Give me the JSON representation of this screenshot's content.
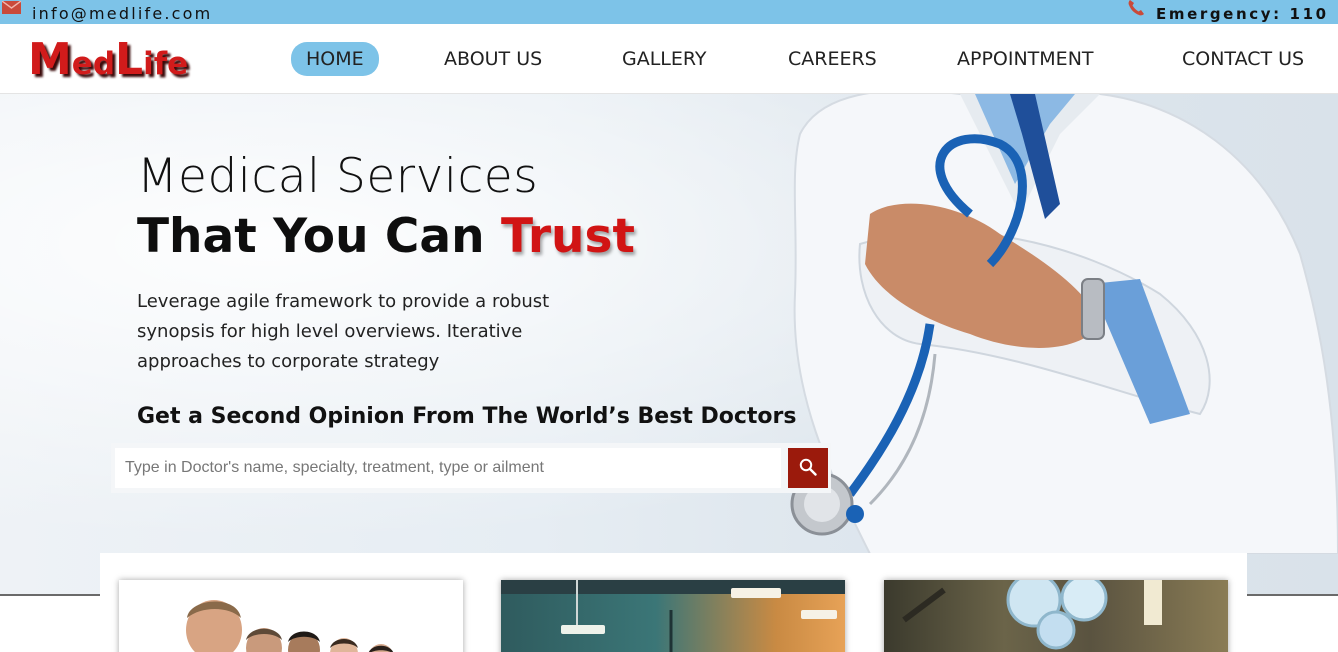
{
  "topbar": {
    "email": "info@medlife.com",
    "emergency": "Emergency: 110",
    "email_icon": "mail-icon",
    "phone_icon": "phone-icon"
  },
  "header": {
    "logo": {
      "part1_big": "M",
      "part1_small": "ed",
      "part2_big": "L",
      "part2_small": "ife"
    },
    "nav": [
      {
        "label": "HOME",
        "active": true
      },
      {
        "label": "ABOUT US",
        "active": false
      },
      {
        "label": "GALLERY",
        "active": false
      },
      {
        "label": "CAREERS",
        "active": false
      },
      {
        "label": "APPOINTMENT",
        "active": false
      },
      {
        "label": "CONTACT US",
        "active": false
      }
    ]
  },
  "hero": {
    "line1": "Medical Services",
    "line2_prefix": "That You Can ",
    "line2_highlight": "Trust",
    "body": "Leverage agile framework to provide a robust synopsis for high level overviews. Iterative approaches to corporate strategy",
    "second_opinion": "Get a Second Opinion From The World’s Best Doctors",
    "search": {
      "placeholder": "Type in Doctor's name, specialty, treatment, type or ailment",
      "value": "",
      "button_icon": "search-icon"
    }
  },
  "colors": {
    "topbar": "#7dc3e8",
    "brand_red": "#d11b1b",
    "search_button": "#9b1a0c",
    "nav_active": "#7dc3e8"
  }
}
